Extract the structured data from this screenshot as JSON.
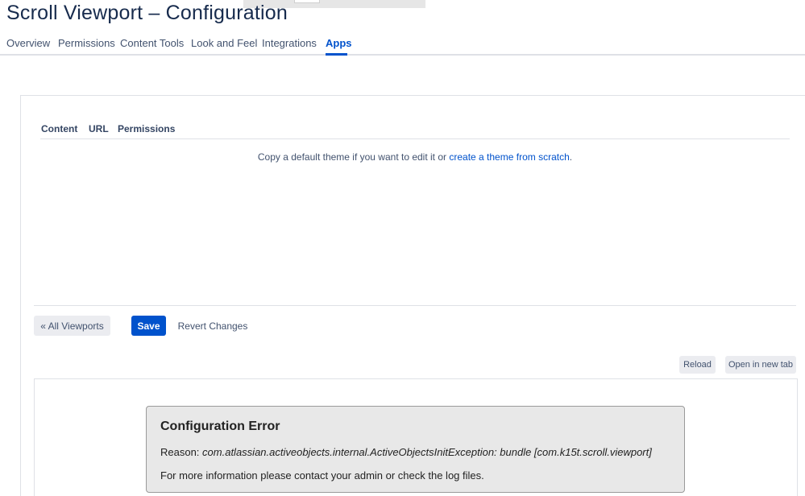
{
  "page": {
    "title": "Scroll Viewport – Configuration"
  },
  "tabs": [
    {
      "label": "Overview",
      "active": false
    },
    {
      "label": "Permissions",
      "active": false
    },
    {
      "label": "Content Tools",
      "active": false
    },
    {
      "label": "Look and Feel",
      "active": false
    },
    {
      "label": "Integrations",
      "active": false
    },
    {
      "label": "Apps",
      "active": true
    }
  ],
  "subtabs": [
    {
      "label": "Content"
    },
    {
      "label": "URL"
    },
    {
      "label": "Permissions"
    }
  ],
  "info": {
    "text_before": "Copy a default theme if you want to edit it or ",
    "link_text": "create a theme from scratch",
    "text_after": "."
  },
  "actions": {
    "all_viewports_label": "« All Viewports",
    "save_label": "Save",
    "revert_label": "Revert Changes"
  },
  "preview_toolbar": {
    "reload_label": "Reload",
    "open_new_tab_label": "Open in new tab"
  },
  "error": {
    "title": "Configuration Error",
    "reason_label": "Reason: ",
    "reason_message": "com.atlassian.activeobjects.internal.ActiveObjectsInitException: bundle [com.k15t.scroll.viewport]",
    "more_info": "For more information please contact your admin or check the log files."
  },
  "colors": {
    "accent": "#0052cc",
    "text": "#172b4d",
    "secondary_button": "#ebecf0",
    "error_box_bg": "#e8e8e8"
  }
}
